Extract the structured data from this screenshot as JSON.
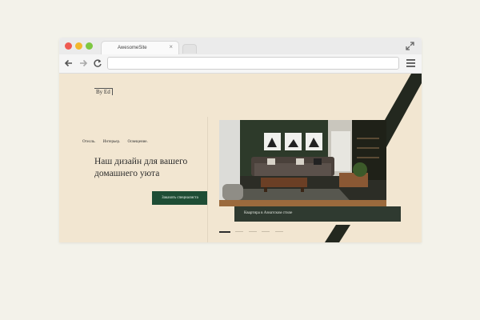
{
  "browser": {
    "tab_title": "AwesomeSite",
    "tab_close": "×",
    "address": ""
  },
  "site": {
    "logo": "By Ed",
    "nav": [
      "Отелль.",
      "Интерьер.",
      "Освещение."
    ],
    "hero_title": "Наш дизайн для вашего домашнего уюта",
    "cta_label": "Заказать специалиста",
    "caption": "Квартира в Азиатском стиле",
    "slides": {
      "count": 5,
      "active": 1
    }
  },
  "colors": {
    "page_bg": "#f2e6d1",
    "accent_green": "#1e4d35",
    "deco_dark": "#23281f",
    "outer_bg": "#f3f2ea"
  }
}
